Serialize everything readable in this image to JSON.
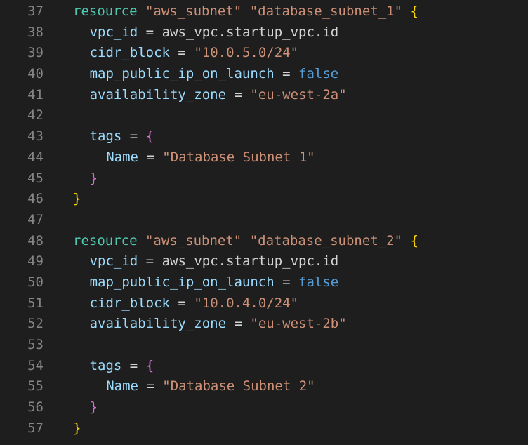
{
  "editor": {
    "colors": {
      "background": "#1e1e1e",
      "line_number": "#858585",
      "keyword": "#4ec9b0",
      "string": "#ce9178",
      "attribute": "#9cdcfe",
      "plain": "#d4d4d4",
      "boolean": "#569cd6",
      "brace_level_1": "#ffd700",
      "brace_level_2": "#da70d6"
    },
    "lines": [
      {
        "number": "37",
        "indent": 0,
        "tokens": [
          {
            "t": "resource",
            "c": "keyword"
          },
          {
            "t": " ",
            "c": "plain"
          },
          {
            "t": "\"aws_subnet\"",
            "c": "string"
          },
          {
            "t": " ",
            "c": "plain"
          },
          {
            "t": "\"database_subnet_1\"",
            "c": "string"
          },
          {
            "t": " ",
            "c": "plain"
          },
          {
            "t": "{",
            "c": "brace1"
          }
        ]
      },
      {
        "number": "38",
        "indent": 1,
        "tokens": [
          {
            "t": "vpc_id",
            "c": "attr"
          },
          {
            "t": " = ",
            "c": "op"
          },
          {
            "t": "aws_vpc.startup_vpc.id",
            "c": "plain"
          }
        ]
      },
      {
        "number": "39",
        "indent": 1,
        "tokens": [
          {
            "t": "cidr_block",
            "c": "attr"
          },
          {
            "t": " = ",
            "c": "op"
          },
          {
            "t": "\"10.0.5.0/24\"",
            "c": "string"
          }
        ]
      },
      {
        "number": "40",
        "indent": 1,
        "tokens": [
          {
            "t": "map_public_ip_on_launch",
            "c": "attr"
          },
          {
            "t": " = ",
            "c": "op"
          },
          {
            "t": "false",
            "c": "bool"
          }
        ]
      },
      {
        "number": "41",
        "indent": 1,
        "tokens": [
          {
            "t": "availability_zone",
            "c": "attr"
          },
          {
            "t": " = ",
            "c": "op"
          },
          {
            "t": "\"eu-west-2a\"",
            "c": "string"
          }
        ]
      },
      {
        "number": "42",
        "indent": 1,
        "tokens": []
      },
      {
        "number": "43",
        "indent": 1,
        "tokens": [
          {
            "t": "tags",
            "c": "attr"
          },
          {
            "t": " = ",
            "c": "op"
          },
          {
            "t": "{",
            "c": "brace2"
          }
        ]
      },
      {
        "number": "44",
        "indent": 2,
        "tokens": [
          {
            "t": "Name",
            "c": "attr"
          },
          {
            "t": " = ",
            "c": "op"
          },
          {
            "t": "\"Database Subnet 1\"",
            "c": "string"
          }
        ]
      },
      {
        "number": "45",
        "indent": 1,
        "tokens": [
          {
            "t": "}",
            "c": "brace2"
          }
        ]
      },
      {
        "number": "46",
        "indent": 0,
        "tokens": [
          {
            "t": "}",
            "c": "brace1"
          }
        ]
      },
      {
        "number": "47",
        "indent": 0,
        "tokens": []
      },
      {
        "number": "48",
        "indent": 0,
        "tokens": [
          {
            "t": "resource",
            "c": "keyword"
          },
          {
            "t": " ",
            "c": "plain"
          },
          {
            "t": "\"aws_subnet\"",
            "c": "string"
          },
          {
            "t": " ",
            "c": "plain"
          },
          {
            "t": "\"database_subnet_2\"",
            "c": "string"
          },
          {
            "t": " ",
            "c": "plain"
          },
          {
            "t": "{",
            "c": "brace1"
          }
        ]
      },
      {
        "number": "49",
        "indent": 1,
        "tokens": [
          {
            "t": "vpc_id",
            "c": "attr"
          },
          {
            "t": " = ",
            "c": "op"
          },
          {
            "t": "aws_vpc.startup_vpc.id",
            "c": "plain"
          }
        ]
      },
      {
        "number": "50",
        "indent": 1,
        "tokens": [
          {
            "t": "map_public_ip_on_launch",
            "c": "attr"
          },
          {
            "t": " = ",
            "c": "op"
          },
          {
            "t": "false",
            "c": "bool"
          }
        ]
      },
      {
        "number": "51",
        "indent": 1,
        "tokens": [
          {
            "t": "cidr_block",
            "c": "attr"
          },
          {
            "t": " = ",
            "c": "op"
          },
          {
            "t": "\"10.0.4.0/24\"",
            "c": "string"
          }
        ]
      },
      {
        "number": "52",
        "indent": 1,
        "tokens": [
          {
            "t": "availability_zone",
            "c": "attr"
          },
          {
            "t": " = ",
            "c": "op"
          },
          {
            "t": "\"eu-west-2b\"",
            "c": "string"
          }
        ]
      },
      {
        "number": "53",
        "indent": 1,
        "tokens": []
      },
      {
        "number": "54",
        "indent": 1,
        "tokens": [
          {
            "t": "tags",
            "c": "attr"
          },
          {
            "t": " = ",
            "c": "op"
          },
          {
            "t": "{",
            "c": "brace2"
          }
        ]
      },
      {
        "number": "55",
        "indent": 2,
        "tokens": [
          {
            "t": "Name",
            "c": "attr"
          },
          {
            "t": " = ",
            "c": "op"
          },
          {
            "t": "\"Database Subnet 2\"",
            "c": "string"
          }
        ]
      },
      {
        "number": "56",
        "indent": 1,
        "tokens": [
          {
            "t": "}",
            "c": "brace2"
          }
        ]
      },
      {
        "number": "57",
        "indent": 0,
        "tokens": [
          {
            "t": "}",
            "c": "brace1"
          }
        ]
      }
    ]
  }
}
